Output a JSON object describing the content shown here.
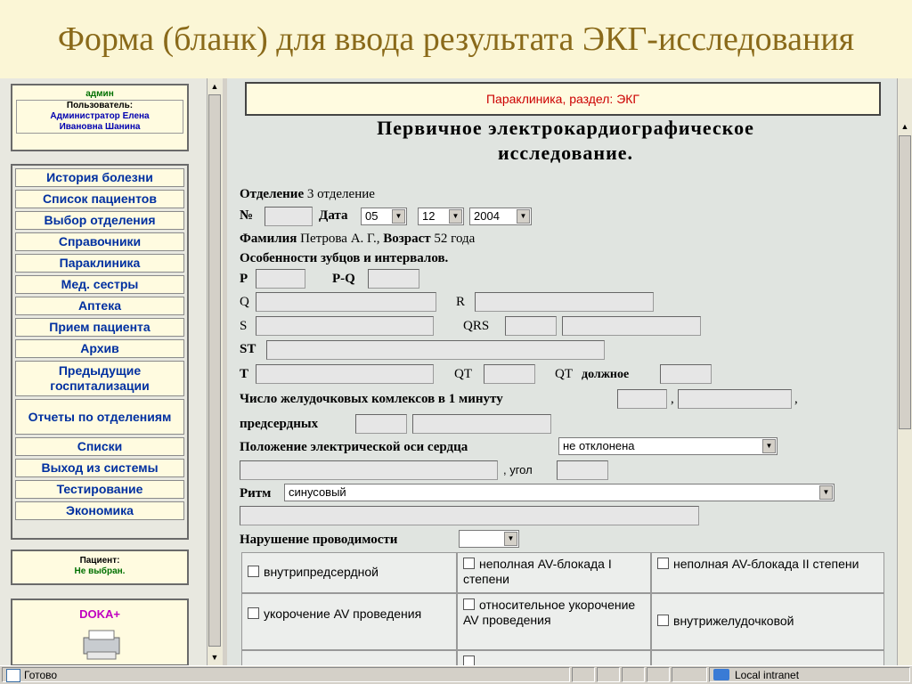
{
  "slide": {
    "title": "Форма (бланк) для ввода результата ЭКГ-исследования"
  },
  "left": {
    "role": "админ",
    "user_label": "Пользователь:",
    "user_line1": "Администратор Елена",
    "user_line2": "Ивановна Шанина",
    "nav": [
      {
        "label": "История болезни"
      },
      {
        "label": "Список пациентов"
      },
      {
        "label": "Выбор отделения"
      },
      {
        "label": "Справочники"
      },
      {
        "label": "Параклиника"
      },
      {
        "label": "Мед. сестры"
      },
      {
        "label": "Аптека"
      },
      {
        "label": "Прием пациента"
      },
      {
        "label": "Архив"
      },
      {
        "label": "Предыдущие госпитализации"
      },
      {
        "label": "Отчеты по отделениям"
      },
      {
        "label": "Списки"
      },
      {
        "label": "Выход из системы"
      },
      {
        "label": "Тестирование"
      },
      {
        "label": "Экономика"
      }
    ],
    "patient_label": "Пациент:",
    "patient_value": "Не выбран.",
    "logo": "DOKA+"
  },
  "form": {
    "banner": "Параклиника, раздел: ЭКГ",
    "heading1": "Первичное электрокардиографическое",
    "heading2": "исследование.",
    "dept_label": "Отделение",
    "dept_value": "3 отделение",
    "num_label": "№",
    "date_label": "Дата",
    "day": "05",
    "month": "12",
    "year": "2004",
    "name_label": "Фамилия",
    "name_value": "Петрова А. Г.,",
    "age_label": "Возраст",
    "age_value": "52 года",
    "features_label": "Особенности зубцов и интервалов.",
    "p": "P",
    "pq": "P-Q",
    "q": "Q",
    "r": "R",
    "s": "S",
    "qrs": "QRS",
    "st": "ST",
    "t": "T",
    "qt": "QT",
    "qt_due": "QT должное",
    "vent_label": "Число желудочковых комлексов в 1 минуту",
    "comma": ",",
    "atrial_label": "предсердных",
    "axis_label": "Положение электрической оси сердца",
    "axis_value": "не отклонена",
    "angle_label": ", угол",
    "rhythm_label": "Ритм",
    "rhythm_value": "синусовый",
    "conduction_label": "Нарушение проводимости",
    "checks": [
      {
        "label": "внутрипредсердной"
      },
      {
        "label": "неполная AV-блокада I степени"
      },
      {
        "label": "неполная AV-блокада II степени"
      },
      {
        "label": "укорочение AV проведения"
      },
      {
        "label": "относительное укорочение AV проведения"
      },
      {
        "label": "внутрижелудочковой"
      }
    ]
  },
  "status": {
    "text": "Готово",
    "zone": "Local intranet"
  }
}
